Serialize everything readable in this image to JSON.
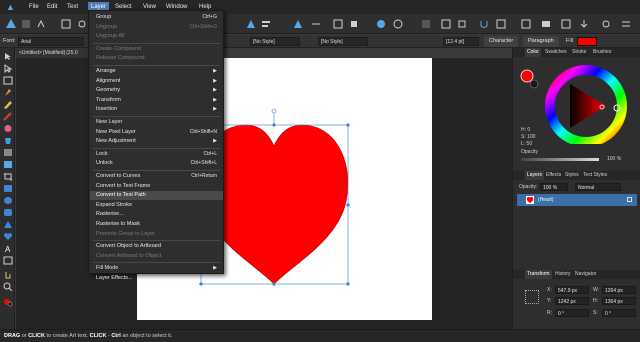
{
  "menubar": {
    "items": [
      {
        "label": "File",
        "active": false
      },
      {
        "label": "Edit",
        "active": false
      },
      {
        "label": "Text",
        "active": false
      },
      {
        "label": "Layer",
        "active": true
      },
      {
        "label": "Select",
        "active": false
      },
      {
        "label": "View",
        "active": false
      },
      {
        "label": "Window",
        "active": false
      },
      {
        "label": "Help",
        "active": false
      }
    ]
  },
  "context_bar": {
    "font_label": "Font:",
    "font_value": "Arial",
    "style_a": "[No Style]",
    "style_b": "[No Style]",
    "size": "[12.4 pt]",
    "character": "Character",
    "paragraph": "Paragraph",
    "fill_label": "Fill",
    "fill_color": "#ff0000"
  },
  "document_tab": "<Untitled> [Modified] (25.0",
  "layer_menu": {
    "groups": [
      [
        {
          "label": "Group",
          "shortcut": "Ctrl+G",
          "disabled": false
        },
        {
          "label": "Ungroup",
          "shortcut": "Ctrl+Shift+G",
          "disabled": true
        },
        {
          "label": "Ungroup All",
          "shortcut": "",
          "disabled": true
        }
      ],
      [
        {
          "label": "Create Compound",
          "shortcut": "",
          "disabled": true
        },
        {
          "label": "Release Compound",
          "shortcut": "",
          "disabled": true
        }
      ],
      [
        {
          "label": "Arrange",
          "submenu": true
        },
        {
          "label": "Alignment",
          "submenu": true
        },
        {
          "label": "Geometry",
          "submenu": true
        },
        {
          "label": "Transform",
          "submenu": true
        },
        {
          "label": "Insertion",
          "submenu": true
        }
      ],
      [
        {
          "label": "New Layer",
          "shortcut": ""
        },
        {
          "label": "New Pixel Layer",
          "shortcut": "Ctrl+Shift+N"
        },
        {
          "label": "New Adjustment",
          "submenu": true
        }
      ],
      [
        {
          "label": "Lock",
          "shortcut": "Ctrl+L"
        },
        {
          "label": "Unlock",
          "shortcut": "Ctrl+Shift+L"
        }
      ],
      [
        {
          "label": "Convert to Curves",
          "shortcut": "Ctrl+Return"
        },
        {
          "label": "Convert to Text Frame",
          "shortcut": ""
        },
        {
          "label": "Convert to Text Path",
          "shortcut": "",
          "highlighted": true
        },
        {
          "label": "Expand Stroke",
          "shortcut": ""
        },
        {
          "label": "Rasterise...",
          "shortcut": ""
        },
        {
          "label": "Rasterise to Mask",
          "shortcut": ""
        },
        {
          "label": "Promote Group to Layer",
          "shortcut": "",
          "disabled": true
        }
      ],
      [
        {
          "label": "Convert Object to Artboard",
          "shortcut": ""
        },
        {
          "label": "Convert Artboard to Object",
          "shortcut": "",
          "disabled": true
        }
      ],
      [
        {
          "label": "Fill Mode",
          "submenu": true
        },
        {
          "label": "Layer Effects...",
          "shortcut": ""
        }
      ]
    ]
  },
  "color_panel": {
    "tabs": [
      "Color",
      "Swatches",
      "Stroke",
      "Brushes"
    ],
    "h": "H: 0",
    "s": "S: 100",
    "l": "L: 50",
    "opacity_label": "Opacity",
    "opacity_value": "100 %"
  },
  "layers_panel": {
    "tabs": [
      "Layers",
      "Effects",
      "Styles",
      "Text Styles"
    ],
    "opacity_label": "Opacity:",
    "opacity_value": "100 %",
    "blend_mode": "Normal",
    "layer_name": "(Heart)"
  },
  "transform_panel": {
    "tabs": [
      "Transform",
      "History",
      "Navigator"
    ],
    "x": "547.9 px",
    "y": "1242 px",
    "w": "1264 px",
    "h": "1364 px",
    "r": "0 °",
    "s": "0 °"
  },
  "status": {
    "b1": "DRAG",
    "t1": " or ",
    "b2": "CLICK",
    "t2": " to create Art text. ",
    "b3": "CLICK",
    "t3": " - ",
    "b4": "Ctrl",
    "t4": " an object to select it."
  },
  "colors": {
    "accent": "#4f7bb5",
    "heart": "#ff0000",
    "selection": "#3e7fd6"
  }
}
